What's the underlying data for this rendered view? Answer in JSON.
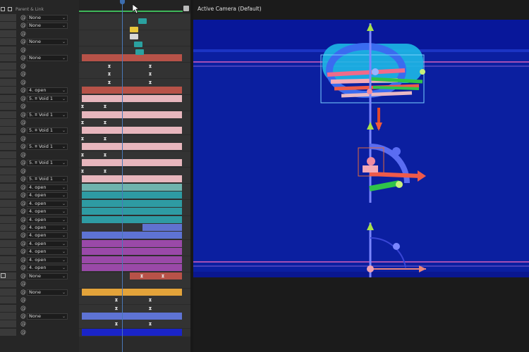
{
  "viewer": {
    "title": "Active Camera (Default)"
  },
  "layers_header": {
    "label": "Parent & Link"
  },
  "layer_rows": [
    {
      "kind": "dd",
      "text": "None"
    },
    {
      "kind": "dd",
      "text": "None"
    },
    {
      "kind": "spiral"
    },
    {
      "kind": "dd",
      "text": "None"
    },
    {
      "kind": "spiral"
    },
    {
      "kind": "dd",
      "text": "None"
    },
    {
      "kind": "spiral"
    },
    {
      "kind": "spiral"
    },
    {
      "kind": "spiral"
    },
    {
      "kind": "dd",
      "text": "4. open"
    },
    {
      "kind": "dd",
      "text": "5. ⌗ Void 1"
    },
    {
      "kind": "spiral"
    },
    {
      "kind": "dd",
      "text": "5. ⌗ Void 1"
    },
    {
      "kind": "spiral"
    },
    {
      "kind": "dd",
      "text": "5. ⌗ Void 1"
    },
    {
      "kind": "spiral"
    },
    {
      "kind": "dd",
      "text": "5. ⌗ Void 1"
    },
    {
      "kind": "spiral"
    },
    {
      "kind": "dd",
      "text": "5. ⌗ Void 1"
    },
    {
      "kind": "spiral"
    },
    {
      "kind": "dd",
      "text": "5. ⌗ Void 1"
    },
    {
      "kind": "dd",
      "text": "4. open"
    },
    {
      "kind": "dd",
      "text": "4. open"
    },
    {
      "kind": "dd",
      "text": "4. open"
    },
    {
      "kind": "dd",
      "text": "4. open"
    },
    {
      "kind": "dd",
      "text": "4. open"
    },
    {
      "kind": "dd",
      "text": "4. open"
    },
    {
      "kind": "dd",
      "text": "4. open"
    },
    {
      "kind": "dd",
      "text": "4. open"
    },
    {
      "kind": "dd",
      "text": "4. open"
    },
    {
      "kind": "dd",
      "text": "4. open"
    },
    {
      "kind": "dd",
      "text": "4. open"
    },
    {
      "kind": "dd",
      "text": "None"
    },
    {
      "kind": "spiral"
    },
    {
      "kind": "dd",
      "text": "None"
    },
    {
      "kind": "spiral"
    },
    {
      "kind": "spiral"
    },
    {
      "kind": "dd",
      "text": "None"
    },
    {
      "kind": "spiral"
    },
    {
      "kind": "spiral"
    }
  ]
}
